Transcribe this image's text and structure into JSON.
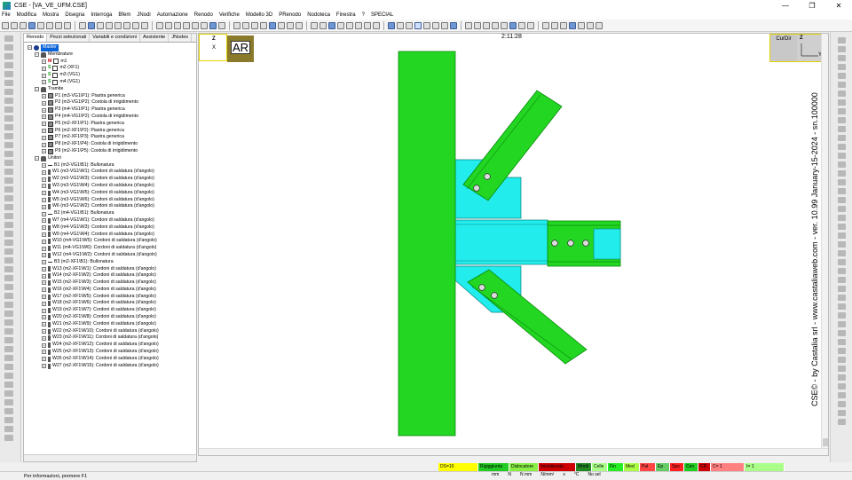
{
  "window": {
    "title": "CSE - [VA_VE_UFM.CSE]"
  },
  "menu": [
    "File",
    "Modifica",
    "Mostra",
    "Disegna",
    "Interroga",
    "Bfem",
    "JNodi",
    "Automazione",
    "Renodo",
    "Verifiche",
    "Modello 3D",
    "PRenodo",
    "Nodoteca",
    "Finestra",
    "?",
    "SPECIAL"
  ],
  "tabs": [
    "Renodo",
    "Pezzi selezionati",
    "Variabili e condizioni",
    "Assistente",
    "JNodes"
  ],
  "tree": {
    "master": "Master",
    "membrature_label": "Membrature",
    "membrature": [
      {
        "prefix": "M",
        "label": "m1"
      },
      {
        "prefix": "S",
        "label": "m2 (XF1)"
      },
      {
        "prefix": "S",
        "label": "m3 (VG1)"
      },
      {
        "prefix": "S",
        "label": "m4 (VG1)"
      }
    ],
    "tramite_label": "Tramite",
    "tramite": [
      "P1 (m3-VG1\\P1): Piastra generica",
      "P2 (m3-VG1\\P2): Costola di irrigidimento",
      "P3 (m4-VG1\\P1): Piastra generica",
      "P4 (m4-VG1\\P2): Costola di irrigidimento",
      "P5 (m2-XF1\\P1): Piastra generica",
      "P6 (m2-XF1\\P2): Piastra generica",
      "P7 (m2-XF1\\P3): Piastra generica",
      "P8 (m2-XF1\\P4): Costola di irrigidimento",
      "P9 (m2-XF1\\P5): Costola di irrigidimento"
    ],
    "unitori_label": "Unitori",
    "unitori": [
      {
        "t": "bolt",
        "label": "B1 (m3-VG1\\B1): Bullonatura"
      },
      {
        "t": "weld",
        "label": "W1 (m3-VG1\\W1): Cordoni di saldatura (d'angolo)"
      },
      {
        "t": "weld",
        "label": "W2 (m3-VG1\\W3): Cordoni di saldatura (d'angolo)"
      },
      {
        "t": "weld",
        "label": "W3 (m3-VG1\\W4): Cordoni di saldatura (d'angolo)"
      },
      {
        "t": "weld",
        "label": "W4 (m3-VG1\\W5): Cordoni di saldatura (d'angolo)"
      },
      {
        "t": "weld",
        "label": "W5 (m3-VG1\\W6): Cordoni di saldatura (d'angolo)"
      },
      {
        "t": "weld",
        "label": "W6 (m3-VG1\\W2): Cordoni di saldatura (d'angolo)"
      },
      {
        "t": "bolt",
        "label": "B2 (m4-VG1\\B1): Bullonatura"
      },
      {
        "t": "weld",
        "label": "W7 (m4-VG1\\W1): Cordoni di saldatura (d'angolo)"
      },
      {
        "t": "weld",
        "label": "W8 (m4-VG1\\W3): Cordoni di saldatura (d'angolo)"
      },
      {
        "t": "weld",
        "label": "W9 (m4-VG1\\W4): Cordoni di saldatura (d'angolo)"
      },
      {
        "t": "weld",
        "label": "W10 (m4-VG1\\W5): Cordoni di saldatura (d'angolo)"
      },
      {
        "t": "weld",
        "label": "W11 (m4-VG1\\W6): Cordoni di saldatura (d'angolo)"
      },
      {
        "t": "weld",
        "label": "W12 (m4-VG1\\W2): Cordoni di saldatura (d'angolo)"
      },
      {
        "t": "bolt",
        "label": "B3 (m2-XF1\\B1): Bullonatura"
      },
      {
        "t": "weld",
        "label": "W13 (m2-XF1\\W1): Cordoni di saldatura (d'angolo)"
      },
      {
        "t": "weld",
        "label": "W14 (m2-XF1\\W2): Cordoni di saldatura (d'angolo)"
      },
      {
        "t": "weld",
        "label": "W15 (m2-XF1\\W3): Cordoni di saldatura (d'angolo)"
      },
      {
        "t": "weld",
        "label": "W16 (m2-XF1\\W4): Cordoni di saldatura (d'angolo)"
      },
      {
        "t": "weld",
        "label": "W17 (m2-XF1\\W5): Cordoni di saldatura (d'angolo)"
      },
      {
        "t": "weld",
        "label": "W18 (m2-XF1\\W6): Cordoni di saldatura (d'angolo)"
      },
      {
        "t": "weld",
        "label": "W19 (m2-XF1\\W7): Cordoni di saldatura (d'angolo)"
      },
      {
        "t": "weld",
        "label": "W20 (m2-XF1\\W8): Cordoni di saldatura (d'angolo)"
      },
      {
        "t": "weld",
        "label": "W21 (m2-XF1\\W9): Cordoni di saldatura (d'angolo)"
      },
      {
        "t": "weld",
        "label": "W22 (m2-XF1\\W10): Cordoni di saldatura (d'angolo)"
      },
      {
        "t": "weld",
        "label": "W23 (m2-XF1\\W11): Cordoni di saldatura (d'angolo)"
      },
      {
        "t": "weld",
        "label": "W24 (m2-XF1\\W12): Cordoni di saldatura (d'angolo)"
      },
      {
        "t": "weld",
        "label": "W25 (m2-XF1\\W13): Cordoni di saldatura (d'angolo)"
      },
      {
        "t": "weld",
        "label": "W26 (m2-XF1\\W14): Cordoni di saldatura (d'angolo)"
      },
      {
        "t": "weld",
        "label": "W27 (m2-XF1\\W15): Cordoni di saldatura (d'angolo)"
      }
    ]
  },
  "viewport": {
    "view_label": "AR",
    "time": "2:11:28",
    "curdir_label": "CurDir",
    "axis_z": "Z",
    "axis_x": "X",
    "axis_y": "Y",
    "credits": "CSE© - by Castalia srl - www.castaliaweb.com - ver. 10.99 January-15-2024 - sn.100000",
    "colors": {
      "member": "#22d622",
      "member_dark": "#0a8a0a",
      "plate": "#22ecec",
      "plate_stroke": "#0a8080"
    }
  },
  "legend": [
    {
      "label": "DS=10",
      "color": "#ffff00"
    },
    {
      "label": "Rigiggiunta",
      "color": "#22cc22"
    },
    {
      "label": "Dislocatore",
      "color": "#88ee44"
    },
    {
      "label": "Inizializzata",
      "color": "#cc0000"
    },
    {
      "label": "Mmdi",
      "color": "#228822"
    },
    {
      "label": "Celle",
      "color": "#aaff88"
    },
    {
      "label": "Fin",
      "color": "#22ee22"
    },
    {
      "label": "Med",
      "color": "#aaff44"
    },
    {
      "label": "Pal",
      "color": "#ff4444"
    },
    {
      "label": "Ep",
      "color": "#66cc66"
    },
    {
      "label": "Spo",
      "color": "#ff2222"
    },
    {
      "label": "Cen",
      "color": "#22cc22"
    },
    {
      "label": "CR",
      "color": "#cc0000"
    },
    {
      "label": "C= 1",
      "color": "#ff8080"
    },
    {
      "label": "I= 1",
      "color": "#aaff88"
    }
  ],
  "units": [
    "mm",
    "N",
    "N mm",
    "N/mm²",
    "s",
    "°C",
    "No sel"
  ],
  "status": {
    "message": "Per informazioni, premere F1"
  }
}
